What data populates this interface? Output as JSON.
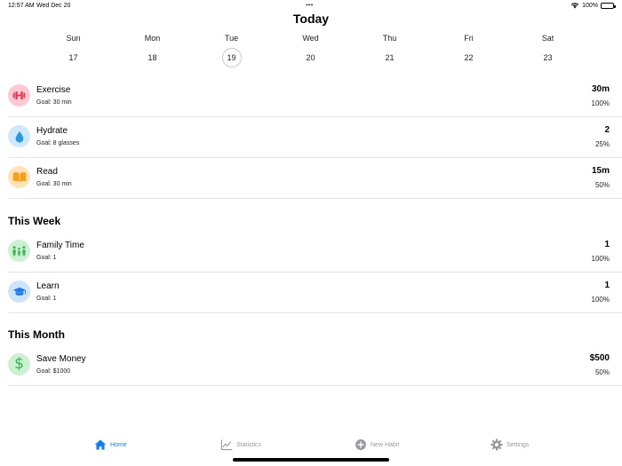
{
  "status_bar": {
    "time": "12:57 AM",
    "date": "Wed Dec 20",
    "dots": "•••",
    "battery": "100%"
  },
  "title": "Today",
  "week": [
    {
      "name": "Sun",
      "num": "17",
      "selected": false
    },
    {
      "name": "Mon",
      "num": "18",
      "selected": false
    },
    {
      "name": "Tue",
      "num": "19",
      "selected": true
    },
    {
      "name": "Wed",
      "num": "20",
      "selected": false
    },
    {
      "name": "Thu",
      "num": "21",
      "selected": false
    },
    {
      "name": "Fri",
      "num": "22",
      "selected": false
    },
    {
      "name": "Sat",
      "num": "23",
      "selected": false
    }
  ],
  "today": {
    "habits": [
      {
        "name": "Exercise",
        "goal": "Goal: 30 min",
        "value": "30m",
        "percent": "100%",
        "icon": "dumbbell-icon",
        "color": "#ffc9d4",
        "icon_color": "#e8304f"
      },
      {
        "name": "Hydrate",
        "goal": "Goal: 8 glasses",
        "value": "2",
        "percent": "25%",
        "icon": "water-drop-icon",
        "color": "#cfe8fb",
        "icon_color": "#2a9ae0"
      },
      {
        "name": "Read",
        "goal": "Goal: 30 min",
        "value": "15m",
        "percent": "50%",
        "icon": "book-icon",
        "color": "#ffe3b8",
        "icon_color": "#f5a012"
      }
    ]
  },
  "this_week": {
    "header": "This Week",
    "habits": [
      {
        "name": "Family Time",
        "goal": "Goal: 1",
        "value": "1",
        "percent": "100%",
        "icon": "family-icon",
        "color": "#cdf0d2",
        "icon_color": "#34b552"
      },
      {
        "name": "Learn",
        "goal": "Goal: 1",
        "value": "1",
        "percent": "100%",
        "icon": "graduation-cap-icon",
        "color": "#cfe4fb",
        "icon_color": "#1a7cf2"
      }
    ]
  },
  "this_month": {
    "header": "This Month",
    "habits": [
      {
        "name": "Save Money",
        "goal": "Goal: $1000",
        "value": "$500",
        "percent": "50%",
        "icon": "dollar-icon",
        "color": "#cdf0d2",
        "icon_color": "#34b552"
      }
    ]
  },
  "tabs": [
    {
      "label": "Home",
      "icon": "house-icon",
      "active": true
    },
    {
      "label": "Statistics",
      "icon": "chart-icon",
      "active": false
    },
    {
      "label": "New Habit",
      "icon": "plus-circle-icon",
      "active": false
    },
    {
      "label": "Settings",
      "icon": "gear-icon",
      "active": false
    }
  ],
  "colors": {
    "accent": "#1a7cf2",
    "inactive_tab": "#9a9a9e",
    "divider": "#e3e3e6"
  }
}
